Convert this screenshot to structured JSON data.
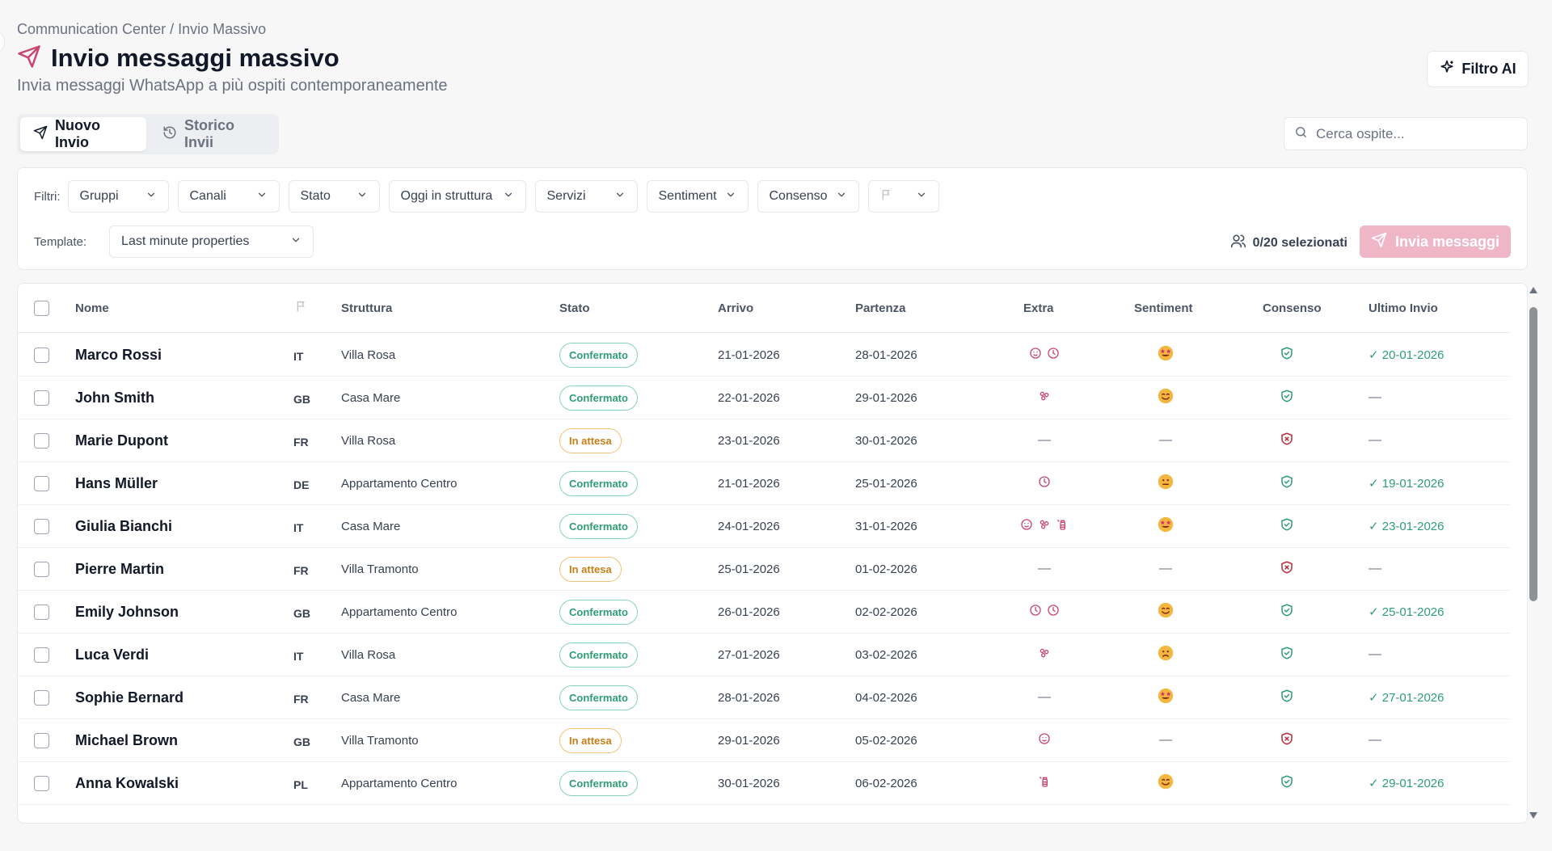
{
  "breadcrumb": "Communication Center / Invio Massivo",
  "title": "Invio messaggi massivo",
  "subtitle": "Invia messaggi WhatsApp a più ospiti contemporaneamente",
  "ai_filter_label": "Filtro AI",
  "tabs": [
    {
      "label": "Nuovo Invio",
      "icon": "send-icon",
      "active": true
    },
    {
      "label": "Storico Invii",
      "icon": "history-icon",
      "active": false
    }
  ],
  "search": {
    "placeholder": "Cerca ospite..."
  },
  "filters": {
    "label": "Filtri:",
    "items": [
      "Gruppi",
      "Canali",
      "Stato",
      "Oggi in struttura",
      "Servizi",
      "Sentiment",
      "Consenso",
      ""
    ]
  },
  "template": {
    "label": "Template:",
    "value": "Last minute properties"
  },
  "selection": {
    "count": "0/20 selezionati"
  },
  "send_button": "Invia messaggi",
  "colors": {
    "accent": "#c9466e",
    "success": "#2f9d74",
    "warning": "#c77e16",
    "danger": "#b42d3c",
    "send_disabled": "#eeb6c6"
  },
  "table": {
    "headers": {
      "name": "Nome",
      "flag": "",
      "structure": "Struttura",
      "status": "Stato",
      "arrival": "Arrivo",
      "departure": "Partenza",
      "extra": "Extra",
      "sentiment": "Sentiment",
      "consent": "Consenso",
      "last_sent": "Ultimo Invio"
    },
    "rows": [
      {
        "name": "Marco Rossi",
        "country": "IT",
        "structure": "Villa Rosa",
        "status": "Confermato",
        "arrival": "21-01-2026",
        "departure": "28-01-2026",
        "extra": [
          "timer-icon",
          "clock-icon"
        ],
        "sentiment": "star-struck-emoji",
        "consent": "shield-check-icon",
        "last_sent": "✓ 20-01-2026"
      },
      {
        "name": "John Smith",
        "country": "GB",
        "structure": "Casa Mare",
        "status": "Confermato",
        "arrival": "22-01-2026",
        "departure": "29-01-2026",
        "extra": [
          "spa-icon"
        ],
        "sentiment": "smile-emoji",
        "consent": "shield-check-icon",
        "last_sent": "—"
      },
      {
        "name": "Marie Dupont",
        "country": "FR",
        "structure": "Villa Rosa",
        "status": "In attesa",
        "arrival": "23-01-2026",
        "departure": "30-01-2026",
        "extra": [],
        "sentiment": "",
        "consent": "shield-x-icon",
        "last_sent": "—"
      },
      {
        "name": "Hans Müller",
        "country": "DE",
        "structure": "Appartamento Centro",
        "status": "Confermato",
        "arrival": "21-01-2026",
        "departure": "25-01-2026",
        "extra": [
          "clock-icon"
        ],
        "sentiment": "neutral-emoji",
        "consent": "shield-check-icon",
        "last_sent": "✓ 19-01-2026"
      },
      {
        "name": "Giulia Bianchi",
        "country": "IT",
        "structure": "Casa Mare",
        "status": "Confermato",
        "arrival": "24-01-2026",
        "departure": "31-01-2026",
        "extra": [
          "timer-icon",
          "spa-icon",
          "baby-bottle-icon"
        ],
        "sentiment": "star-struck-emoji",
        "consent": "shield-check-icon",
        "last_sent": "✓ 23-01-2026"
      },
      {
        "name": "Pierre Martin",
        "country": "FR",
        "structure": "Villa Tramonto",
        "status": "In attesa",
        "arrival": "25-01-2026",
        "departure": "01-02-2026",
        "extra": [],
        "sentiment": "",
        "consent": "shield-x-icon",
        "last_sent": "—"
      },
      {
        "name": "Emily Johnson",
        "country": "GB",
        "structure": "Appartamento Centro",
        "status": "Confermato",
        "arrival": "26-01-2026",
        "departure": "02-02-2026",
        "extra": [
          "clock-icon",
          "clock-icon"
        ],
        "sentiment": "smile-emoji",
        "consent": "shield-check-icon",
        "last_sent": "✓ 25-01-2026"
      },
      {
        "name": "Luca Verdi",
        "country": "IT",
        "structure": "Villa Rosa",
        "status": "Confermato",
        "arrival": "27-01-2026",
        "departure": "03-02-2026",
        "extra": [
          "spa-icon"
        ],
        "sentiment": "sad-emoji",
        "consent": "shield-check-icon",
        "last_sent": "—"
      },
      {
        "name": "Sophie Bernard",
        "country": "FR",
        "structure": "Casa Mare",
        "status": "Confermato",
        "arrival": "28-01-2026",
        "departure": "04-02-2026",
        "extra": [],
        "sentiment": "star-struck-emoji",
        "consent": "shield-check-icon",
        "last_sent": "✓ 27-01-2026"
      },
      {
        "name": "Michael Brown",
        "country": "GB",
        "structure": "Villa Tramonto",
        "status": "In attesa",
        "arrival": "29-01-2026",
        "departure": "05-02-2026",
        "extra": [
          "timer-icon"
        ],
        "sentiment": "",
        "consent": "shield-x-icon",
        "last_sent": "—"
      },
      {
        "name": "Anna Kowalski",
        "country": "PL",
        "structure": "Appartamento Centro",
        "status": "Confermato",
        "arrival": "30-01-2026",
        "departure": "06-02-2026",
        "extra": [
          "baby-bottle-icon"
        ],
        "sentiment": "smile-emoji",
        "consent": "shield-check-icon",
        "last_sent": "✓ 29-01-2026"
      }
    ]
  }
}
